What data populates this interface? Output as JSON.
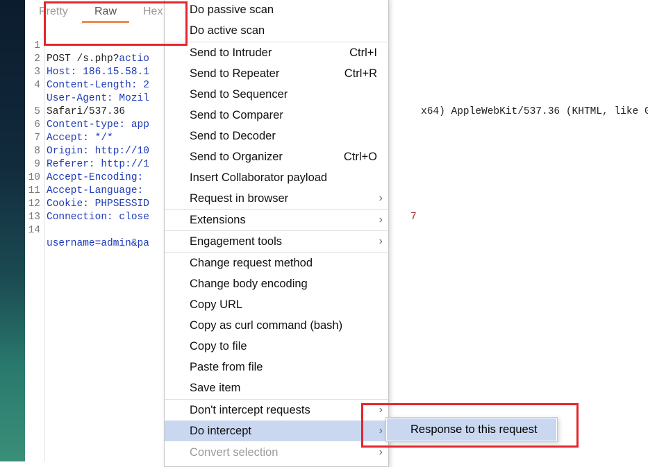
{
  "tabs": [
    {
      "label": "Pretty"
    },
    {
      "label": "Raw"
    },
    {
      "label": "Hex"
    }
  ],
  "request_lines": [
    {
      "n": "1",
      "text": "POST /s.php?",
      "extra": "actio"
    },
    {
      "n": "2",
      "text": "Host: 186.15.58.1"
    },
    {
      "n": "3",
      "text": "Content-Length: 2"
    },
    {
      "n": "4",
      "text": "User-Agent: Mozil",
      "tail": "x64) AppleWebKit/537.36 (KHTML, like G"
    },
    {
      "n": "",
      "text": "Safari/537.36"
    },
    {
      "n": "5",
      "text": "Content-type: app"
    },
    {
      "n": "6",
      "text": "Accept: */*"
    },
    {
      "n": "7",
      "text": "Origin: http://10"
    },
    {
      "n": "8",
      "text": "Referer: http://1"
    },
    {
      "n": "9",
      "text": "Accept-Encoding: "
    },
    {
      "n": "10",
      "text": "Accept-Language: "
    },
    {
      "n": "11",
      "text": "Cookie: PHPSESSID",
      "tail": "7"
    },
    {
      "n": "12",
      "text": "Connection: close"
    },
    {
      "n": "13",
      "text": ""
    },
    {
      "n": "14",
      "text": "username=admin&pa"
    }
  ],
  "context_menu": {
    "items": [
      {
        "label": "Do passive scan"
      },
      {
        "label": "Do active scan"
      },
      {
        "label": "Send to Intruder",
        "shortcut": "Ctrl+I"
      },
      {
        "label": "Send to Repeater",
        "shortcut": "Ctrl+R"
      },
      {
        "label": "Send to Sequencer"
      },
      {
        "label": "Send to Comparer"
      },
      {
        "label": "Send to Decoder"
      },
      {
        "label": "Send to Organizer",
        "shortcut": "Ctrl+O"
      },
      {
        "label": "Insert Collaborator payload"
      },
      {
        "label": "Request in browser"
      },
      {
        "label": "Extensions"
      },
      {
        "label": "Engagement tools"
      },
      {
        "label": "Change request method"
      },
      {
        "label": "Change body encoding"
      },
      {
        "label": "Copy URL"
      },
      {
        "label": "Copy as curl command (bash)"
      },
      {
        "label": "Copy to file"
      },
      {
        "label": "Paste from file"
      },
      {
        "label": "Save item"
      },
      {
        "label": "Don't intercept requests"
      },
      {
        "label": "Do intercept"
      },
      {
        "label": "Convert selection"
      }
    ]
  },
  "submenu": {
    "items": [
      {
        "label": "Response to this request"
      }
    ]
  },
  "colors": {
    "highlight_border": "#e3262d",
    "menu_active_bg": "#c9d8f0",
    "tab_underline": "#f08a4b"
  }
}
